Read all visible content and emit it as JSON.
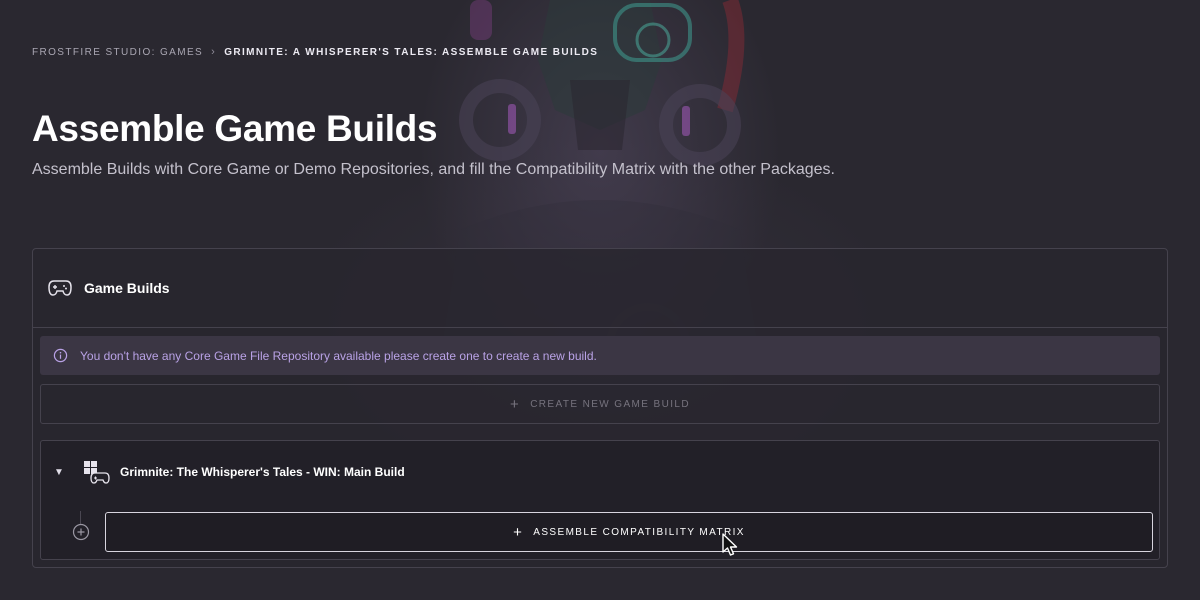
{
  "breadcrumb": {
    "parent": "FROSTFIRE STUDIO: GAMES",
    "separator": "›",
    "current": "GRIMNITE: A WHISPERER'S TALES: ASSEMBLE GAME BUILDS"
  },
  "header": {
    "title": "Assemble Game Builds",
    "subtitle": "Assemble Builds with Core Game or Demo Repositories, and fill the Compatibility Matrix with the other Packages."
  },
  "panel": {
    "title": "Game Builds",
    "info_message": "You don't have any Core Game File Repository available please create one to create a new build.",
    "create_button_label": "CREATE NEW GAME BUILD",
    "build": {
      "name": "Grimnite: The Whisperer's Tales -  WIN: Main Build",
      "assemble_button_label": "ASSEMBLE COMPATIBILITY MATRIX"
    }
  },
  "icons": {
    "breadcrumb_separator": "chevron-right-icon",
    "panel": "gamepad-icon",
    "info": "info-icon",
    "expand": "caret-down-icon",
    "build": "windows-gamepad-icon",
    "add": "plus-circle-icon",
    "plus": "plus-icon"
  },
  "colors": {
    "background": "#2a2830",
    "info_text": "#b9a2e6",
    "info_background": "#3b3644",
    "panel_border": "#45424d"
  }
}
